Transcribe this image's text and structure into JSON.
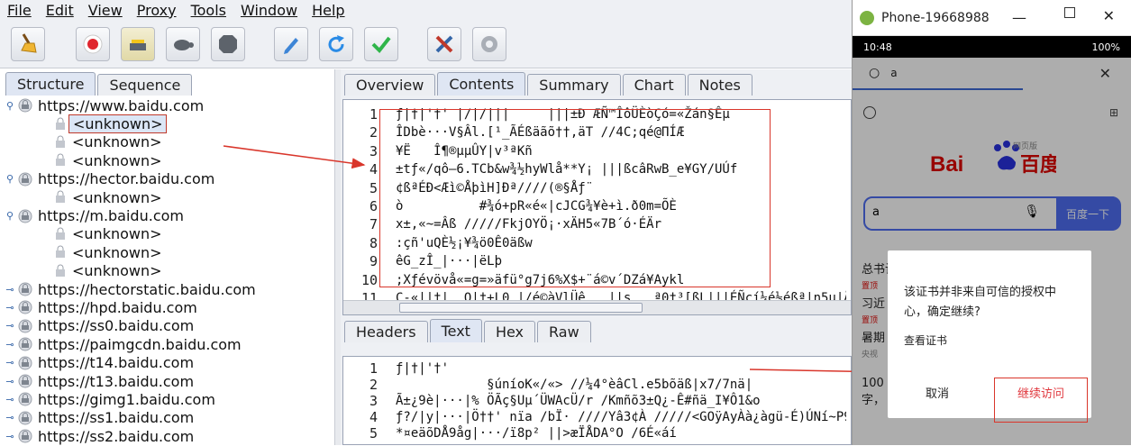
{
  "menu": [
    "File",
    "Edit",
    "View",
    "Proxy",
    "Tools",
    "Window",
    "Help"
  ],
  "toolbar_icons": [
    "broom-icon",
    "record-icon",
    "throttle-icon",
    "turtle-icon",
    "stop-icon",
    "pen-icon",
    "refresh-icon",
    "check-icon",
    "tools-icon",
    "settings-icon"
  ],
  "left_tabs": [
    "Structure",
    "Sequence"
  ],
  "tree": [
    {
      "host": "https://www.baidu.com",
      "children": [
        "<unknown>",
        "<unknown>",
        "<unknown>"
      ]
    },
    {
      "host": "https://hector.baidu.com",
      "children": [
        "<unknown>"
      ]
    },
    {
      "host": "https://m.baidu.com",
      "children": [
        "<unknown>",
        "<unknown>",
        "<unknown>"
      ]
    },
    {
      "host": "https://hectorstatic.baidu.com",
      "children": []
    },
    {
      "host": "https://hpd.baidu.com",
      "children": []
    },
    {
      "host": "https://ss0.baidu.com",
      "children": []
    },
    {
      "host": "https://paimgcdn.baidu.com",
      "children": []
    },
    {
      "host": "https://t14.baidu.com",
      "children": []
    },
    {
      "host": "https://t13.baidu.com",
      "children": []
    },
    {
      "host": "https://gimg1.baidu.com",
      "children": []
    },
    {
      "host": "https://ss1.baidu.com",
      "children": []
    },
    {
      "host": "https://ss2.baidu.com",
      "children": []
    }
  ],
  "right_tabs": [
    "Overview",
    "Contents",
    "Summary",
    "Chart",
    "Notes"
  ],
  "lower_tabs": [
    "Headers",
    "Text",
    "Hex",
    "Raw"
  ],
  "content_lines": [
    "ƒ|†|'†' |/|/|||     |||±Đ ÆÑ™ÎôÜÈòÇó=«Žán§Êµ",
    "ÎDbè···V§Âl.[¹_ÃÉßäãõ††,äT //4C;qé@ΠÍÆ",
    "¥Ë   Î¶®µµÛY|v³ªKñ",
    "±tƒ«/qô–6.TCb&w¾½hyWlå**Y¡ |||ßcâRwB_e¥GY/UÚf",
    "¢ßªÉÐ<Æì©ÅþìH]Ðª////(®§Åƒ¨",
    "ò          #¾ó+pR«é«|cJCG¾¥è+ì.ð0m=ÕÈ",
    "x±,«~=Âß /////FkjOYÖ¡·xÄH5«7B´ó·ÉÄr",
    ":çñ'uQÈ½¡¥¾ö0Ê0äßw",
    "êG_zÎ_|···|ëLþ",
    ";Xƒévövå«=g=»äfü°g7j6%X$+¨á©v´DZá¥Aykl",
    "C-«||†|_ O|†+L0 |/é©àVlÜê   ||s   ª0†³[ßL|||ÉÑçí¼é½éßª|n5µ|Ån"
  ],
  "text_lines": [
    "ƒ|†|'†'",
    "            §úníoK«/«> //¼4°èâCl.e5bõäß|x7/7nä|",
    "Ã±¿9è|···|% ÖÃç§Uµ´ÜWAcÜ/r /Kmñõ3±Q¿-Ê#ñä_I¥Ô1&o",
    "ƒ?/|y|···|Ö††' nïa /bÏ· ////Yâ3¢À /////<GOÿAyÀà¿àgü-É)ÚNí~P9.",
    "*¤eäõDÅ9åg|···/ï8p² ||>æÏÅDA°O /6É«áí"
  ],
  "phone": {
    "title": "Phone-19668988",
    "time": "10:48",
    "battery": "100%",
    "search_text": "a",
    "brand_sub": "网页版",
    "brand": "Bai du百度",
    "input_text": "a",
    "search_btn": "百度一下",
    "feed": [
      "总书记",
      "置顶",
      "习近",
      "置顶",
      "暑期",
      "央视",
      "100",
      "字，"
    ],
    "dialog_text": "该证书并非来自可信的授权中心，确定继续?",
    "dialog_link": "查看证书",
    "cancel": "取消",
    "continue": "继续访问"
  }
}
